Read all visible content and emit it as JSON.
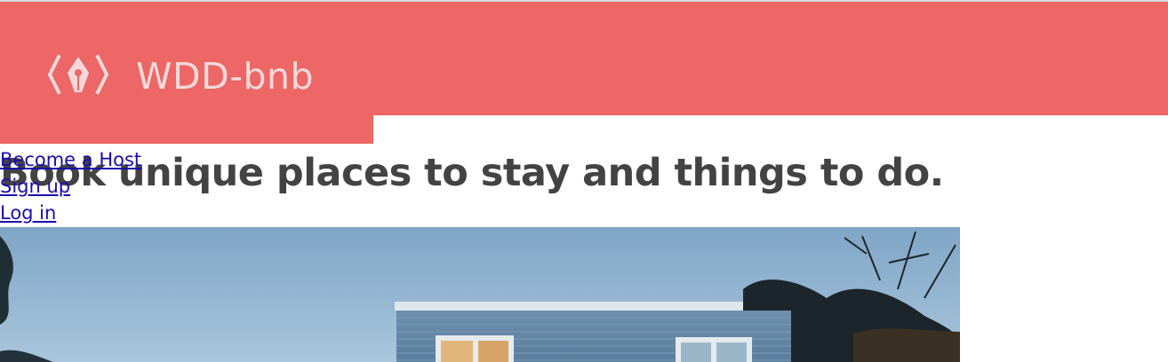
{
  "brand": {
    "name": "WDD-bnb",
    "logo_icon": "pen-nib-code-brackets-icon",
    "accent_color": "#ec6765"
  },
  "nav": {
    "become_host": "Become a Host",
    "sign_up": "Sign up",
    "log_in": "Log in"
  },
  "hero": {
    "tagline": "Book unique places to stay and things to do."
  }
}
